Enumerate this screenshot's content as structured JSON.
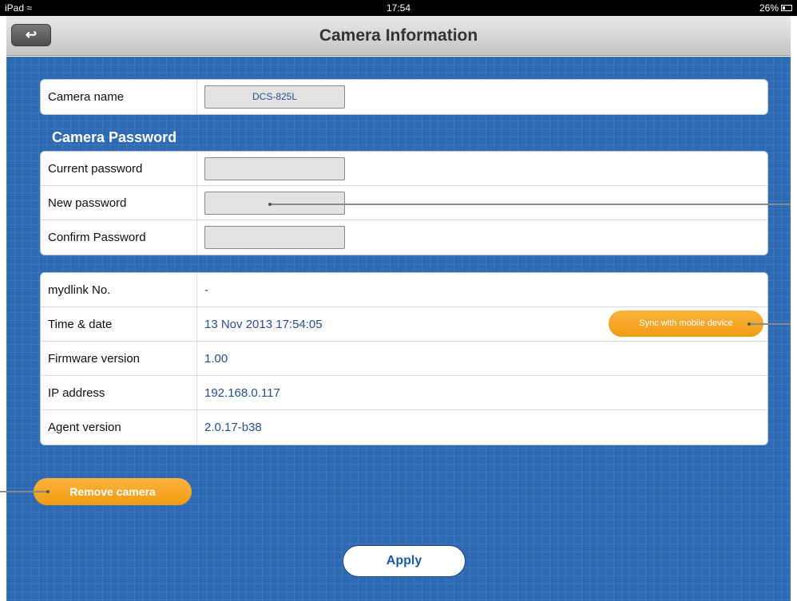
{
  "status_bar": {
    "device": "iPad",
    "wifi_icon": "wifi-icon",
    "time": "17:54",
    "battery": "26%"
  },
  "nav": {
    "back_icon": "back-arrow-icon",
    "back_glyph": "↩",
    "title": "Camera Information"
  },
  "camera": {
    "name_label": "Camera name",
    "name_value": "DCS-825L"
  },
  "password": {
    "section_title": "Camera Password",
    "current_label": "Current password",
    "current_value": "",
    "new_label": "New password",
    "new_value": "",
    "confirm_label": "Confirm Password",
    "confirm_value": ""
  },
  "info": {
    "rows": [
      {
        "label": "mydlink No.",
        "value": "-"
      },
      {
        "label": "Time & date",
        "value": "13 Nov 2013 17:54:05"
      },
      {
        "label": "Firmware version",
        "value": "1.00"
      },
      {
        "label": "IP address",
        "value": "192.168.0.117"
      },
      {
        "label": "Agent version",
        "value": "2.0.17-b38"
      }
    ]
  },
  "buttons": {
    "sync": "Sync with mobile device",
    "remove": "Remove camera",
    "apply": "Apply"
  },
  "colors": {
    "background": "#2e6ab3",
    "accent_orange": "#f5a623",
    "value_text": "#2a4f91"
  }
}
